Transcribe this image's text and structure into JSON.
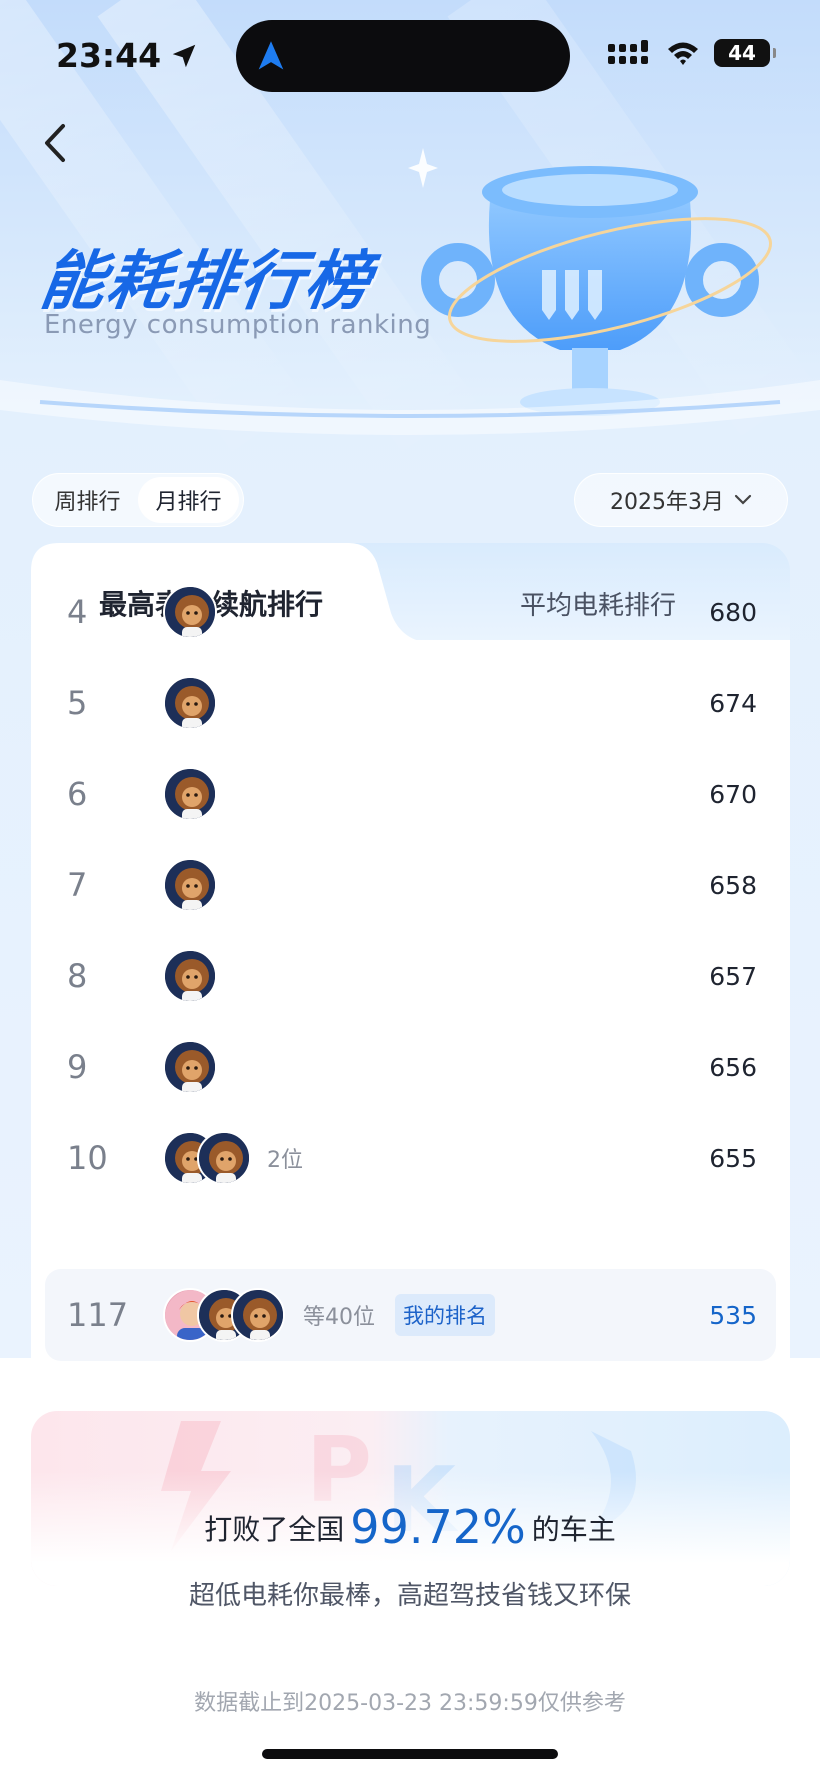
{
  "status_bar": {
    "time": "23:44",
    "battery": "44"
  },
  "hero": {
    "title": "能耗排行榜",
    "subtitle": "Energy consumption ranking"
  },
  "period_toggle": {
    "options": [
      "周排行",
      "月排行"
    ],
    "selected": "月排行"
  },
  "month_select": {
    "value": "2025年3月"
  },
  "tabs": {
    "active": "最高表显续航排行",
    "inactive": "平均电耗排行"
  },
  "ranking": [
    {
      "rank": "4",
      "value": "680",
      "extra": ""
    },
    {
      "rank": "5",
      "value": "674",
      "extra": ""
    },
    {
      "rank": "6",
      "value": "670",
      "extra": ""
    },
    {
      "rank": "7",
      "value": "658",
      "extra": ""
    },
    {
      "rank": "8",
      "value": "657",
      "extra": ""
    },
    {
      "rank": "9",
      "value": "656",
      "extra": ""
    },
    {
      "rank": "10",
      "value": "655",
      "extra": "2位"
    }
  ],
  "my_rank": {
    "rank": "117",
    "extra": "等40位",
    "badge": "我的排名",
    "value": "535"
  },
  "summary": {
    "beat_prefix": "打败了全国",
    "beat_percent": "99.72%",
    "beat_suffix": "的车主",
    "praise": "超低电耗你最棒，高超驾技省钱又环保",
    "disclaimer": "数据截止到2025-03-23 23:59:59仅供参考"
  },
  "colors": {
    "accent": "#1565c9",
    "title": "#1768e6",
    "page_bg": "#e3f0fd"
  }
}
